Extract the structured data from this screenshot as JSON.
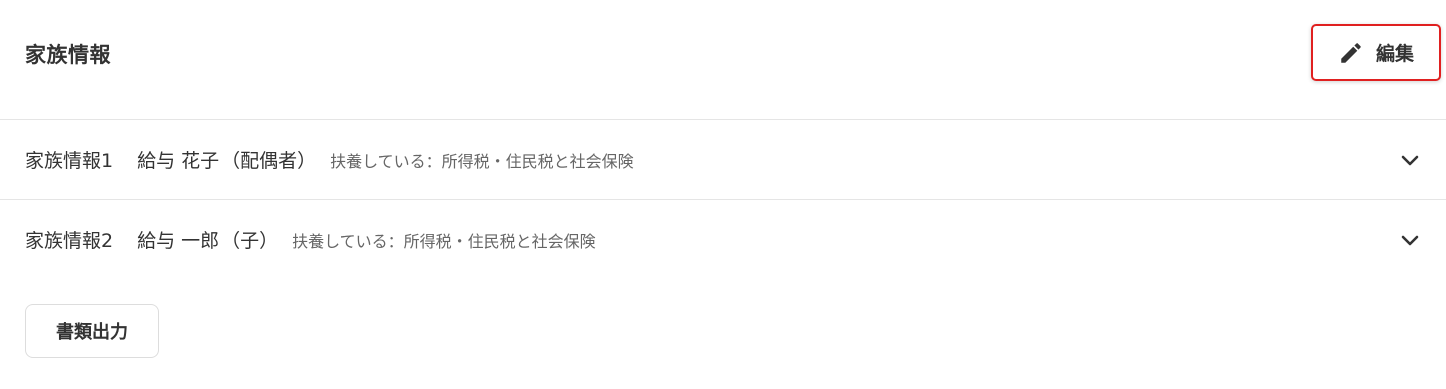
{
  "section": {
    "title": "家族情報",
    "edit_label": "編集"
  },
  "family_members": [
    {
      "index_label": "家族情報1",
      "name": "給与 花子",
      "relation": "（配偶者）",
      "dependency": "扶養している：所得税・住民税と社会保険"
    },
    {
      "index_label": "家族情報2",
      "name": "給与 一郎",
      "relation": "（子）",
      "dependency": "扶養している：所得税・住民税と社会保険"
    }
  ],
  "document_output_label": "書類出力",
  "icons": {
    "edit": "pencil-icon",
    "expand": "chevron-down-icon"
  },
  "colors": {
    "edit_button_border": "#e02020",
    "text": "#333333",
    "subtext": "#666666",
    "divider": "#e5e5e5"
  }
}
